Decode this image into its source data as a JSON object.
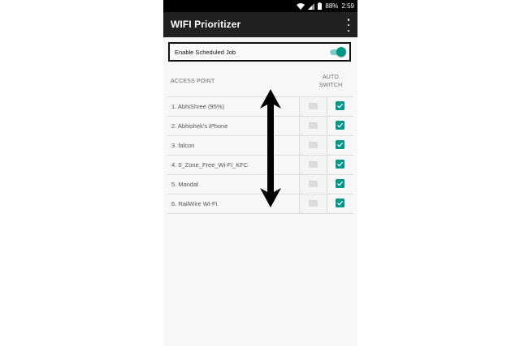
{
  "status_bar": {
    "battery": "88%",
    "time": "2:59"
  },
  "app_bar": {
    "title": "WIFI Prioritizer",
    "menu_icon": "overflow-menu-icon"
  },
  "schedule": {
    "label": "Enable Scheduled Job",
    "enabled": true
  },
  "columns": {
    "access_point": "ACCESS POINT",
    "auto_switch_line1": "AUTO",
    "auto_switch_line2": "SWITCH"
  },
  "access_points": [
    {
      "name": "1. AbhiShree (95%)",
      "auto_switch": true
    },
    {
      "name": "2. Abhishek's iPhone",
      "auto_switch": true
    },
    {
      "name": "3. falcon",
      "auto_switch": true
    },
    {
      "name": "4. 0_Zone_Free_Wi-Fi_KFC",
      "auto_switch": true
    },
    {
      "name": "5. Mandal",
      "auto_switch": true
    },
    {
      "name": "6. RailWire Wi-Fi",
      "auto_switch": true
    }
  ],
  "colors": {
    "accent": "#009688",
    "app_bar": "#212121",
    "status_bar": "#000000"
  }
}
